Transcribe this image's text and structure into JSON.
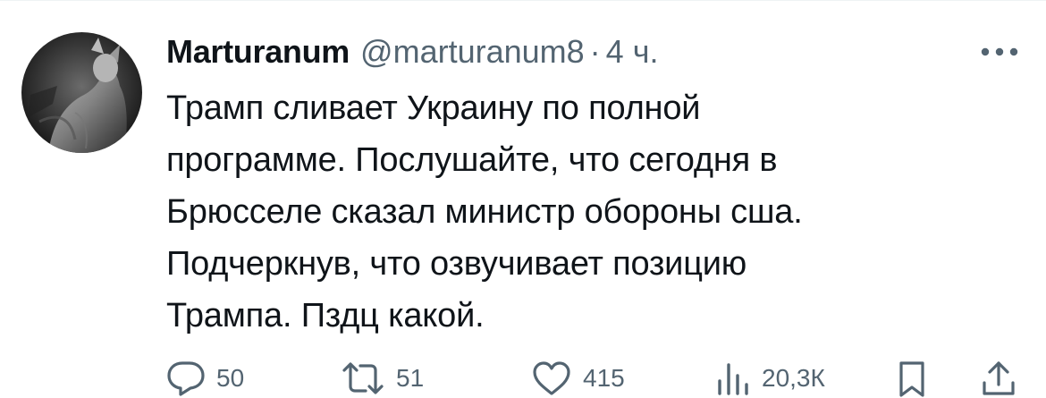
{
  "tweet": {
    "author_name": "Marturanum",
    "handle": "@marturanum8",
    "separator": "·",
    "time": "4 ч.",
    "lines": [
      "Трамп сливает Украину по полной",
      "программе. Послушайте, что сегодня в",
      "Брюсселе сказал министр обороны сша.",
      "Подчеркнув, что озвучивает позицию",
      "Трампа. Пздц какой."
    ]
  },
  "actions": {
    "replies": "50",
    "reposts": "51",
    "likes": "415",
    "views": "20,3К"
  },
  "icons": {
    "more": "more-horizontal-icon",
    "reply": "reply-bubble-icon",
    "repost": "repost-arrows-icon",
    "like": "heart-icon",
    "views": "bar-chart-icon",
    "bookmark": "bookmark-icon",
    "share": "share-upload-icon"
  },
  "colors": {
    "text": "#0f1419",
    "secondary": "#536471",
    "divider": "#eff3f4"
  }
}
